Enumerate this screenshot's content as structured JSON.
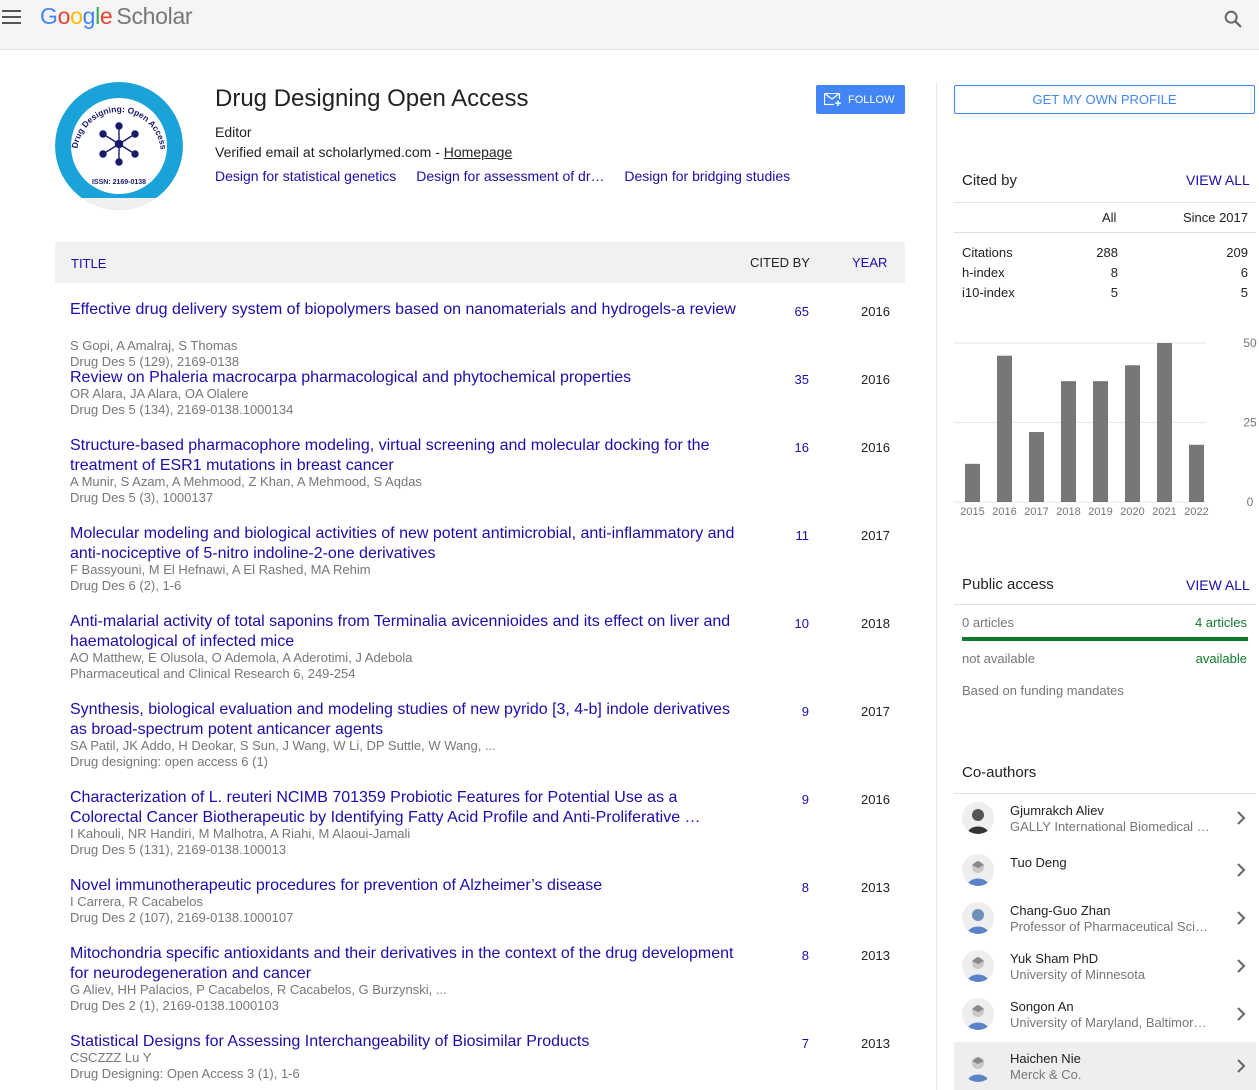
{
  "header": {
    "logo_google": [
      "G",
      "o",
      "o",
      "g",
      "l",
      "e"
    ],
    "logo_scholar": "Scholar",
    "menu_icon": "hamburger-menu-icon",
    "search_icon": "search-icon"
  },
  "profile": {
    "name": "Drug Designing Open Access",
    "affiliation": "Editor",
    "email_text": "Verified email at scholarlymed.com - ",
    "homepage_label": "Homepage",
    "interests": [
      "Design for statistical genetics",
      "Design for assessment of dr…",
      "Design for bridging studies"
    ],
    "follow_label": "FOLLOW",
    "avatar_ring_text": "Drug Designing: Open Access",
    "avatar_issn": "ISSN: 2169-0138"
  },
  "table": {
    "col_title": "TITLE",
    "col_cited": "CITED BY",
    "col_year": "YEAR",
    "rows": [
      {
        "title": "Effective drug delivery system of biopolymers based on nanomaterials and hydrogels-a review",
        "authors": "S Gopi, A Amalraj, S Thomas",
        "venue": "Drug Des 5 (129), 2169-0138",
        "cited": "65",
        "year": "2016"
      },
      {
        "title": "Review on Phaleria macrocarpa pharmacological and phytochemical properties",
        "authors": "OR Alara, JA Alara, OA Olalere",
        "venue": "Drug Des 5 (134), 2169-0138.1000134",
        "cited": "35",
        "year": "2016"
      },
      {
        "title": "Structure-based pharmacophore modeling, virtual screening and molecular docking for the treatment of ESR1 mutations in breast cancer",
        "authors": "A Munir, S Azam, A Mehmood, Z Khan, A Mehmood, S Aqdas",
        "venue": "Drug Des 5 (3), 1000137",
        "cited": "16",
        "year": "2016"
      },
      {
        "title": "Molecular modeling and biological activities of new potent antimicrobial, anti-inflammatory and anti-nociceptive of 5-nitro indoline-2-one derivatives",
        "authors": "F Bassyouni, M El Hefnawi, A El Rashed, MA Rehim",
        "venue": "Drug Des 6 (2), 1-6",
        "cited": "11",
        "year": "2017"
      },
      {
        "title": "Anti-malarial activity of total saponins from Terminalia avicennioides and its effect on liver and haematological of infected mice",
        "authors": "AO Matthew, E Olusola, O Ademola, A Aderotimi, J Adebola",
        "venue": "Pharmaceutical and Clinical Research 6, 249-254",
        "cited": "10",
        "year": "2018"
      },
      {
        "title": "Synthesis, biological evaluation and modeling studies of new pyrido [3, 4-b] indole derivatives as broad-spectrum potent anticancer agents",
        "authors": "SA Patil, JK Addo, H Deokar, S Sun, J Wang, W Li, DP Suttle, W Wang, ...",
        "venue": "Drug designing: open access 6 (1)",
        "cited": "9",
        "year": "2017"
      },
      {
        "title": "Characterization of L. reuteri NCIMB 701359 Probiotic Features for Potential Use as a Colorectal Cancer Biotherapeutic by Identifying Fatty Acid Profile and Anti-Proliferative …",
        "authors": "I Kahouli, NR Handiri, M Malhotra, A Riahi, M Alaoui-Jamali",
        "venue": "Drug Des 5 (131), 2169-0138.100013",
        "cited": "9",
        "year": "2016"
      },
      {
        "title": "Novel immunotherapeutic procedures for prevention of Alzheimer’s disease",
        "authors": "I Carrera, R Cacabelos",
        "venue": "Drug Des 2 (107), 2169-0138.1000107",
        "cited": "8",
        "year": "2013"
      },
      {
        "title": "Mitochondria specific antioxidants and their derivatives in the context of the drug development for neurodegeneration and cancer",
        "authors": "G Aliev, HH Palacios, P Cacabelos, R Cacabelos, G Burzynski, ...",
        "venue": "Drug Des 2 (1), 2169-0138.1000103",
        "cited": "8",
        "year": "2013"
      },
      {
        "title": "Statistical Designs for Assessing Interchangeability of Biosimilar Products",
        "authors": "CSCZZZ Lu Y",
        "venue": "Drug Designing: Open Access 3 (1), 1-6",
        "cited": "7",
        "year": "2013"
      }
    ]
  },
  "sidebar": {
    "get_profile_label": "GET MY OWN PROFILE",
    "cited_by": {
      "title": "Cited by",
      "view_all": "VIEW ALL",
      "col_all": "All",
      "col_since": "Since 2017",
      "metrics": [
        {
          "label": "Citations",
          "all": "288",
          "since": "209"
        },
        {
          "label": "h-index",
          "all": "8",
          "since": "6"
        },
        {
          "label": "i10-index",
          "all": "5",
          "since": "5"
        }
      ]
    },
    "public_access": {
      "title": "Public access",
      "view_all": "VIEW ALL",
      "left_count": "0 articles",
      "right_count": "4 articles",
      "left_status": "not available",
      "right_status": "available",
      "note": "Based on funding mandates",
      "available_fraction": 1.0,
      "bar_color": "#0f7a2b"
    },
    "coauthors": {
      "title": "Co-authors",
      "items": [
        {
          "name": "Gjumrakch Aliev",
          "aff": "GALLY International Biomedical …"
        },
        {
          "name": "Tuo Deng",
          "aff": ""
        },
        {
          "name": "Chang-Guo Zhan",
          "aff": "Professor of Pharmaceutical Sci…"
        },
        {
          "name": "Yuk Sham PhD",
          "aff": "University of Minnesota"
        },
        {
          "name": "Songon An",
          "aff": "University of Maryland, Baltimore…"
        },
        {
          "name": "Haichen Nie",
          "aff": "Merck & Co."
        }
      ]
    }
  },
  "chart_data": {
    "type": "bar",
    "categories": [
      "2015",
      "2016",
      "2017",
      "2018",
      "2019",
      "2020",
      "2021",
      "2022"
    ],
    "values": [
      12,
      46,
      22,
      38,
      38,
      43,
      50,
      18
    ],
    "ylim": [
      0,
      50
    ],
    "yticks": [
      "0",
      "25",
      "50"
    ],
    "grid": true,
    "bar_color": "#777777"
  }
}
